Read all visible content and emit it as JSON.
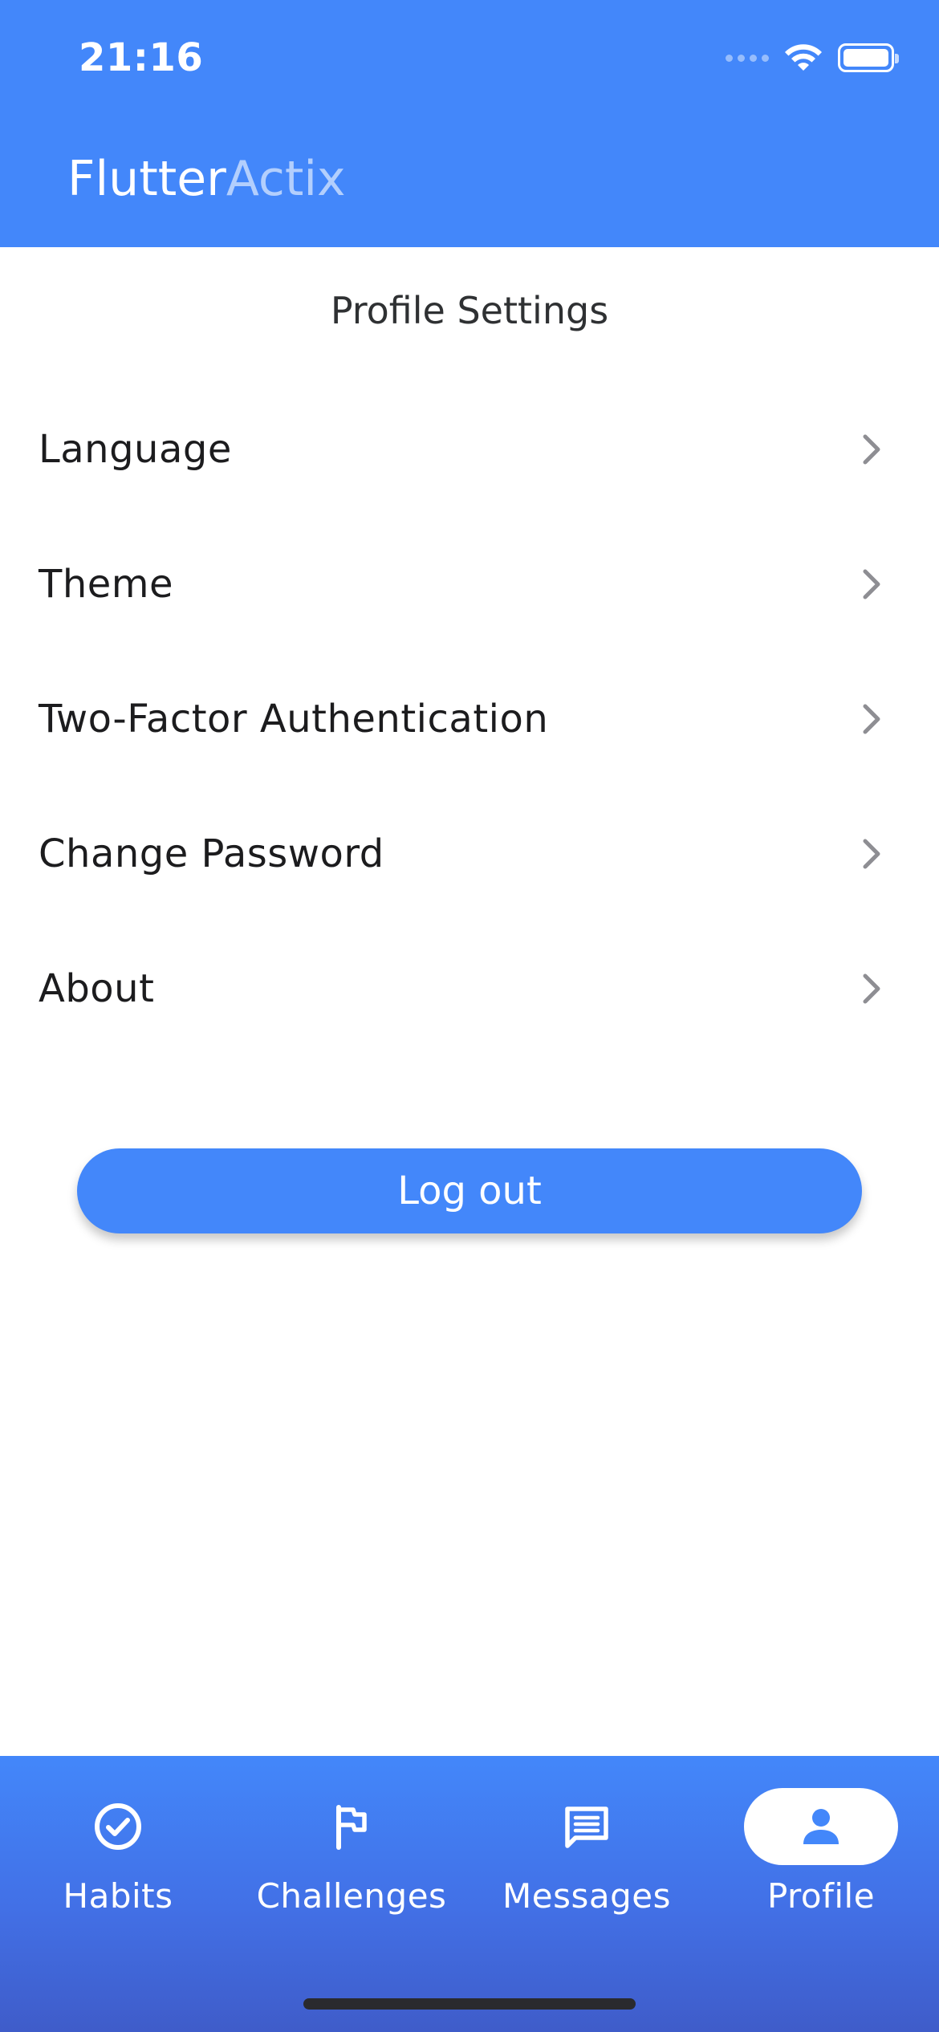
{
  "status_bar": {
    "time": "21:16"
  },
  "app": {
    "brand_part1": "Flutter",
    "brand_part2": "Actix"
  },
  "page": {
    "title": "Profile Settings"
  },
  "settings": {
    "items": [
      {
        "label": "Language"
      },
      {
        "label": "Theme"
      },
      {
        "label": "Two-Factor Authentication"
      },
      {
        "label": "Change Password"
      },
      {
        "label": "About"
      }
    ]
  },
  "actions": {
    "logout_label": "Log out"
  },
  "bottom_nav": {
    "items": [
      {
        "label": "Habits",
        "icon": "check-circle-icon"
      },
      {
        "label": "Challenges",
        "icon": "flag-icon"
      },
      {
        "label": "Messages",
        "icon": "message-icon"
      },
      {
        "label": "Profile",
        "icon": "person-icon",
        "active": true
      }
    ]
  },
  "colors": {
    "primary": "#4387FA",
    "text_dark": "#1c1c1e",
    "chevron": "#8e8e93"
  }
}
